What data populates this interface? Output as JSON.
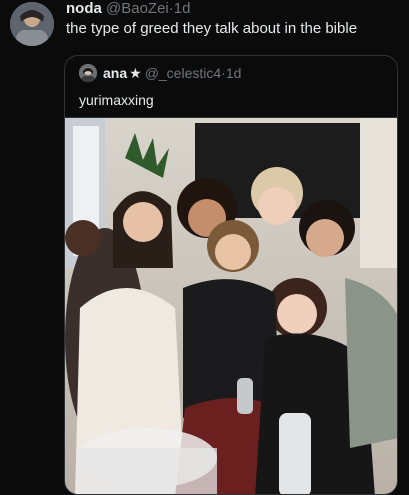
{
  "tweet": {
    "author_name": "noda",
    "author_handle": "@BaoZei",
    "separator": "·",
    "time": "1d",
    "text": "the type of greed they talk about in the bible",
    "avatar_icon": "user-avatar"
  },
  "quoted": {
    "author_name": "ana",
    "star": "★",
    "author_handle": "@_celestic4",
    "separator": "·",
    "time": "1d",
    "text": "yurimaxxing",
    "avatar_icon": "user-avatar",
    "photo_icon": "group-photo"
  },
  "colors": {
    "background": "#0b0b0b",
    "text_primary": "#e7e9ea",
    "text_secondary": "#71767b",
    "border": "#2f3336"
  }
}
